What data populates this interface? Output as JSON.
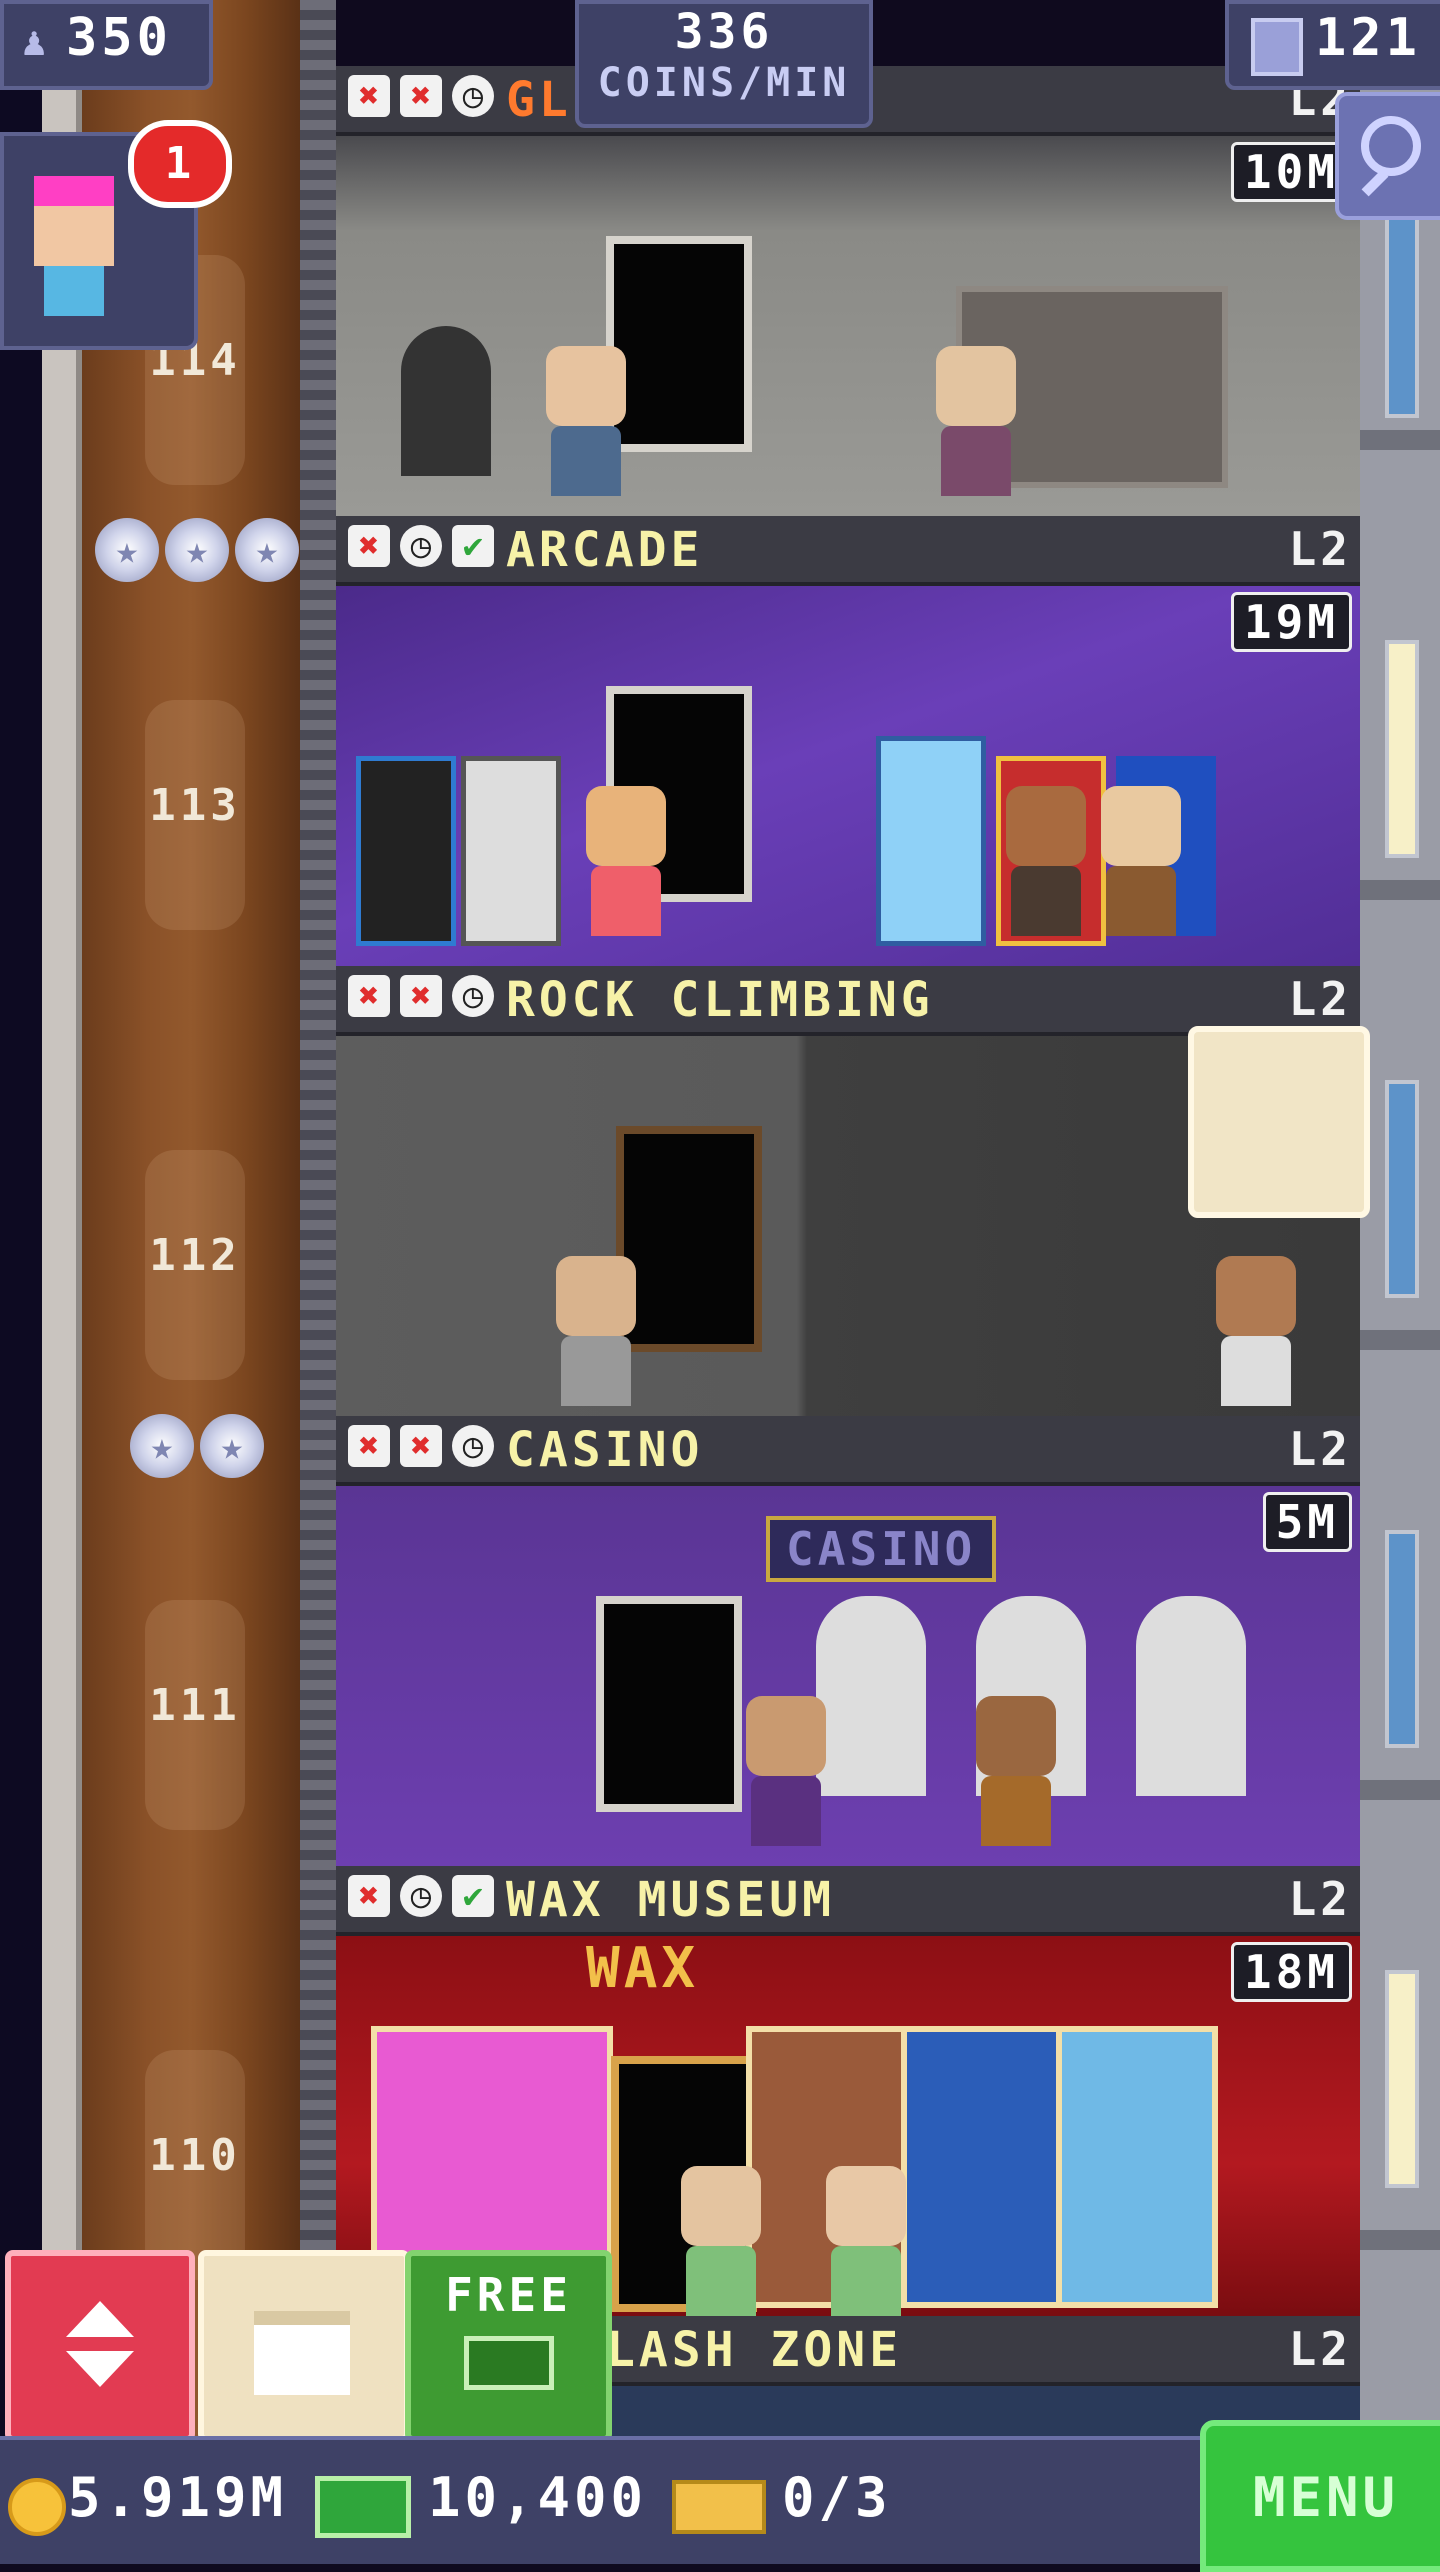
{
  "hud": {
    "population": "350",
    "coins_rate": "336",
    "coins_unit": "COINS/MIN",
    "floor_count": "121",
    "notification_count": "1"
  },
  "floors": [
    {
      "number": "114",
      "name": "GL        IO",
      "level": "L2",
      "price": "10M",
      "stars": 3,
      "icons": [
        "x",
        "x",
        "clock"
      ]
    },
    {
      "number": "113",
      "name": "ARCADE",
      "level": "L2",
      "price": "19M",
      "stars": 0,
      "icons": [
        "x",
        "clock",
        "check"
      ]
    },
    {
      "number": "112",
      "name": "ROCK CLIMBING",
      "level": "L2",
      "price": "",
      "stars": 2,
      "icons": [
        "x",
        "x",
        "clock"
      ]
    },
    {
      "number": "111",
      "name": "CASINO",
      "level": "L2",
      "price": "5M",
      "stars": 0,
      "icons": [
        "x",
        "x",
        "clock"
      ]
    },
    {
      "number": "110",
      "name": "WAX MUSEUM",
      "level": "L2",
      "price": "18M",
      "stars": 0,
      "icons": [
        "x",
        "clock",
        "check"
      ]
    },
    {
      "number": "",
      "name": "LASH ZONE",
      "level": "L2",
      "price": "",
      "stars": 0,
      "icons": []
    }
  ],
  "room_signs": {
    "casino": "CASINO",
    "wax": "WAX"
  },
  "bottom": {
    "coins": "5.919M",
    "bux": "10,400",
    "tickets": "0/3",
    "free_label": "FREE",
    "menu_label": "MENU"
  },
  "colors": {
    "accent_green": "#35c43e",
    "panel": "#3e4166",
    "name_yellow": "#f7f2a8",
    "alert_red": "#e42a2a"
  }
}
